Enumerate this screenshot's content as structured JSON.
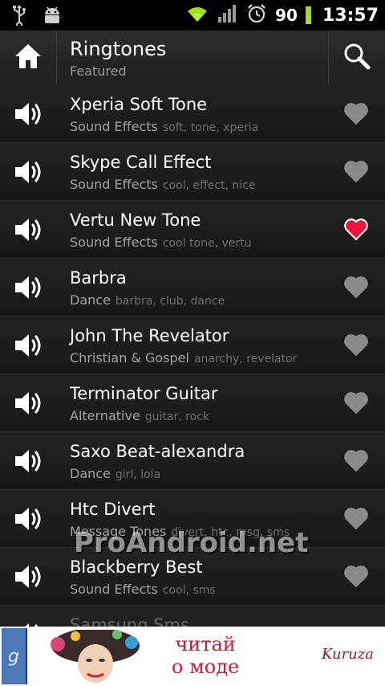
{
  "statusbar": {
    "left_icons": [
      "usb-icon",
      "android-debug-icon"
    ],
    "right_icons": [
      "wifi-icon",
      "signal-icon",
      "alarm-icon"
    ],
    "battery_level": "90",
    "battery_color": "#9ede1f",
    "time": "13:57"
  },
  "actionbar": {
    "title": "Ringtones",
    "subtitle": "Featured",
    "home_icon": "home-icon",
    "search_icon": "search-icon"
  },
  "list": [
    {
      "title": "Xperia Soft Tone",
      "category": "Sound Effects",
      "tags": "soft, tone, xperia",
      "favorite": false
    },
    {
      "title": "Skype Call Effect",
      "category": "Sound Effects",
      "tags": "cool, effect, nice",
      "favorite": false
    },
    {
      "title": "Vertu New Tone",
      "category": "Sound Effects",
      "tags": "cool tone, vertu",
      "favorite": true
    },
    {
      "title": "Barbra",
      "category": "Dance",
      "tags": "barbra, club, dance",
      "favorite": false
    },
    {
      "title": "John The Revelator",
      "category": "Christian & Gospel",
      "tags": "anarchy, revelator",
      "favorite": false
    },
    {
      "title": "Terminator Guitar",
      "category": "Alternative",
      "tags": "guitar, rock",
      "favorite": false
    },
    {
      "title": "Saxo Beat-alexandra",
      "category": "Dance",
      "tags": "girl, lola",
      "favorite": false
    },
    {
      "title": "Htc Divert",
      "category": "Message Tones",
      "tags": "divert, htc, msg, sms",
      "favorite": false
    },
    {
      "title": "Blackberry Best",
      "category": "Sound Effects",
      "tags": "cool, sms",
      "favorite": false
    },
    {
      "title": "Samsung Sms",
      "category": "",
      "tags": "",
      "favorite": false
    }
  ],
  "colors": {
    "heart_inactive": "#8a8a8a",
    "heart_active": "#e8173e"
  },
  "ad": {
    "left_letter": "g",
    "slogan_line1": "читай",
    "slogan_line2": "о моде",
    "brand": "Kuruza"
  },
  "watermark": "ProAndroid.net"
}
